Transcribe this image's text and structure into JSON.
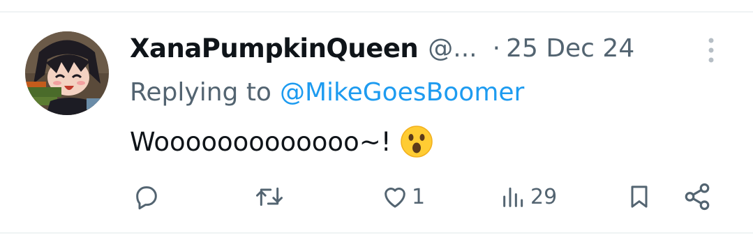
{
  "tweet": {
    "author": {
      "display_name": "XanaPumpkinQueen",
      "handle": "@..."
    },
    "separator": "·",
    "timestamp": "25 Dec 24",
    "reply_prefix": "Replying to",
    "reply_to": "@MikeGoesBoomer",
    "text": "Wooooooooooooo~!",
    "emoji": "astonished-face"
  },
  "actions": {
    "reply_icon": "comment-icon",
    "retweet_icon": "retweet-icon",
    "like_count": "1",
    "views_count": "29",
    "bookmark_icon": "bookmark-icon",
    "share_icon": "share-icon"
  },
  "colors": {
    "text_primary": "#0f1419",
    "text_secondary": "#536471",
    "link": "#1d9bf0",
    "divider": "#eff3f4"
  }
}
